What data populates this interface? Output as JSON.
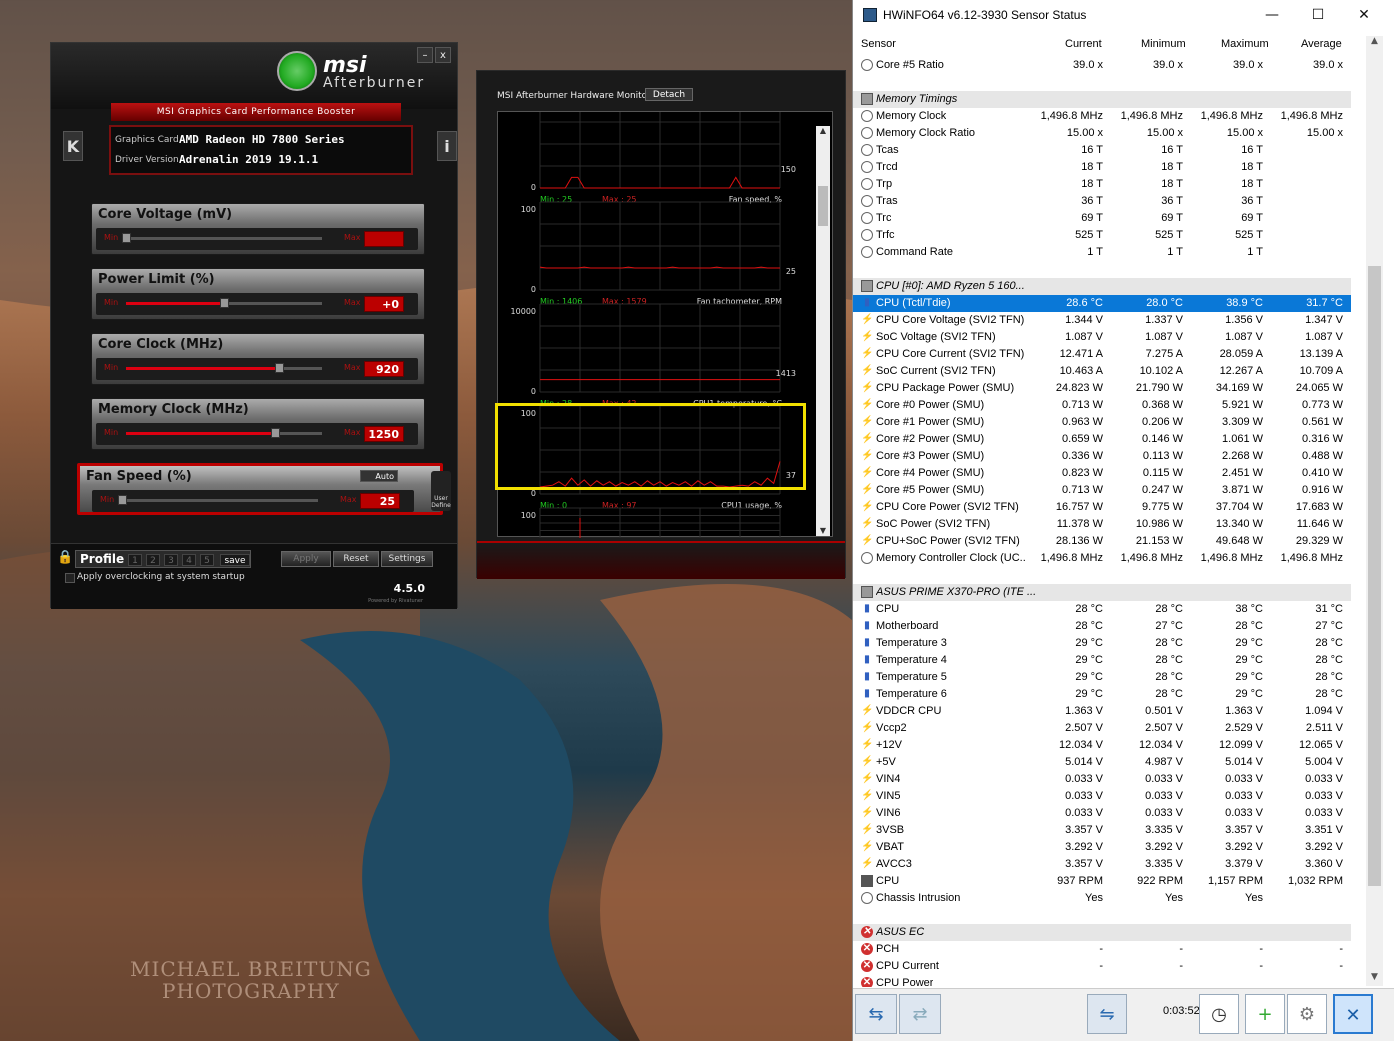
{
  "wallpaper": {
    "watermark_line1": "MICHAEL BREITUNG",
    "watermark_line2": "PHOTOGRAPHY"
  },
  "afterburner": {
    "brand": "msi",
    "product": "Afterburner",
    "banner": "MSI Graphics Card Performance Booster",
    "graphics_card_label": "Graphics Card",
    "graphics_card_value": "AMD Radeon HD 7800 Series",
    "driver_label": "Driver Version",
    "driver_value": "Adrenalin 2019 19.1.1",
    "minimize": "–",
    "close": "x",
    "side_left": "K",
    "side_right": "i",
    "min_label": "Min",
    "max_label": "Max",
    "sliders": [
      {
        "name": "Core Voltage (mV)",
        "value": "",
        "position": 0.0
      },
      {
        "name": "Power Limit (%)",
        "value": "+0",
        "position": 0.5
      },
      {
        "name": "Core Clock (MHz)",
        "value": "920",
        "position": 0.78
      },
      {
        "name": "Memory Clock (MHz)",
        "value": "1250",
        "position": 0.76
      },
      {
        "name": "Fan Speed (%)",
        "value": "25",
        "position": 0.0
      }
    ],
    "fan_auto": "Auto",
    "user_define": "User Define",
    "profile_label": "Profile",
    "profile_slots": [
      "1",
      "2",
      "3",
      "4",
      "5"
    ],
    "save": "save",
    "apply": "Apply",
    "reset": "Reset",
    "settings": "Settings",
    "startup_text": "Apply overclocking at system startup",
    "version": "4.5.0",
    "powered_by": "Powered by Rivatuner"
  },
  "hw_monitor": {
    "title": "MSI Afterburner Hardware Monitor",
    "detach": "Detach",
    "graphs": [
      {
        "ymax": "",
        "ymin": "0",
        "min_text": "Min : 25",
        "max_text": "Max : 25",
        "label": "Fan speed, %",
        "current": "150"
      },
      {
        "ymax": "100",
        "ymin": "0",
        "min_text": "Min : 1406",
        "max_text": "Max : 1579",
        "label": "Fan tachometer, RPM",
        "current": "25"
      },
      {
        "ymax": "10000",
        "ymin": "0",
        "min_text": "Min : 28",
        "max_text": "Max : 42",
        "label": "CPU1 temperature, °C",
        "current": "1413"
      },
      {
        "ymax": "100",
        "ymin": "0",
        "min_text": "Min : 0",
        "max_text": "Max : 97",
        "label": "CPU1 usage, %",
        "current": "37"
      },
      {
        "ymax": "100",
        "ymin": "",
        "min_text": "",
        "max_text": "",
        "label": "",
        "current": ""
      }
    ],
    "highlight_color": "#f2e000",
    "cpu_usage_trace": [
      8,
      9,
      10,
      14,
      9,
      18,
      10,
      16,
      9,
      15,
      10,
      14,
      9,
      13,
      10,
      14,
      9,
      15,
      10,
      14,
      9,
      13,
      10,
      14,
      9,
      15,
      10,
      14,
      9,
      9,
      8,
      9,
      10,
      9,
      14,
      10,
      18,
      12,
      37
    ],
    "fan_speed_trace": [
      0,
      0,
      0,
      0,
      0,
      12,
      12,
      0,
      0,
      0,
      0,
      0,
      0,
      0,
      0,
      0,
      0,
      0,
      0,
      0,
      0,
      0,
      0,
      0,
      0,
      0,
      0,
      0,
      0,
      0,
      0,
      12,
      0,
      0,
      0,
      0,
      0,
      0,
      0
    ]
  },
  "hwinfo": {
    "title": "HWiNFO64 v6.12-3930 Sensor Status",
    "window_min": "—",
    "window_max": "☐",
    "window_close": "✕",
    "columns": [
      "Sensor",
      "Current",
      "Minimum",
      "Maximum",
      "Average"
    ],
    "rows": [
      {
        "type": "item",
        "icon": "clock",
        "name": "Core #5 Ratio",
        "cur": "39.0 x",
        "min": "39.0 x",
        "max": "39.0 x",
        "avg": "39.0 x"
      },
      {
        "type": "blank"
      },
      {
        "type": "group",
        "icon": "mem",
        "name": "Memory Timings"
      },
      {
        "type": "item",
        "icon": "clock",
        "name": "Memory Clock",
        "cur": "1,496.8 MHz",
        "min": "1,496.8 MHz",
        "max": "1,496.8 MHz",
        "avg": "1,496.8 MHz"
      },
      {
        "type": "item",
        "icon": "clock",
        "name": "Memory Clock Ratio",
        "cur": "15.00 x",
        "min": "15.00 x",
        "max": "15.00 x",
        "avg": "15.00 x"
      },
      {
        "type": "item",
        "icon": "clock",
        "name": "Tcas",
        "cur": "16 T",
        "min": "16 T",
        "max": "16 T",
        "avg": ""
      },
      {
        "type": "item",
        "icon": "clock",
        "name": "Trcd",
        "cur": "18 T",
        "min": "18 T",
        "max": "18 T",
        "avg": ""
      },
      {
        "type": "item",
        "icon": "clock",
        "name": "Trp",
        "cur": "18 T",
        "min": "18 T",
        "max": "18 T",
        "avg": ""
      },
      {
        "type": "item",
        "icon": "clock",
        "name": "Tras",
        "cur": "36 T",
        "min": "36 T",
        "max": "36 T",
        "avg": ""
      },
      {
        "type": "item",
        "icon": "clock",
        "name": "Trc",
        "cur": "69 T",
        "min": "69 T",
        "max": "69 T",
        "avg": ""
      },
      {
        "type": "item",
        "icon": "clock",
        "name": "Trfc",
        "cur": "525 T",
        "min": "525 T",
        "max": "525 T",
        "avg": ""
      },
      {
        "type": "item",
        "icon": "clock",
        "name": "Command Rate",
        "cur": "1 T",
        "min": "1 T",
        "max": "1 T",
        "avg": ""
      },
      {
        "type": "blank"
      },
      {
        "type": "group",
        "icon": "mem",
        "name": "CPU [#0]: AMD Ryzen 5 160..."
      },
      {
        "type": "item",
        "icon": "therm",
        "name": "CPU (Tctl/Tdie)",
        "cur": "28.6 °C",
        "min": "28.0 °C",
        "max": "38.9 °C",
        "avg": "31.7 °C",
        "selected": true
      },
      {
        "type": "item",
        "icon": "bolt",
        "name": "CPU Core Voltage (SVI2 TFN)",
        "cur": "1.344 V",
        "min": "1.337 V",
        "max": "1.356 V",
        "avg": "1.347 V"
      },
      {
        "type": "item",
        "icon": "bolt",
        "name": "SoC Voltage (SVI2 TFN)",
        "cur": "1.087 V",
        "min": "1.087 V",
        "max": "1.087 V",
        "avg": "1.087 V"
      },
      {
        "type": "item",
        "icon": "bolt",
        "name": "CPU Core Current (SVI2 TFN)",
        "cur": "12.471 A",
        "min": "7.275 A",
        "max": "28.059 A",
        "avg": "13.139 A"
      },
      {
        "type": "item",
        "icon": "bolt",
        "name": "SoC Current (SVI2 TFN)",
        "cur": "10.463 A",
        "min": "10.102 A",
        "max": "12.267 A",
        "avg": "10.709 A"
      },
      {
        "type": "item",
        "icon": "bolt",
        "name": "CPU Package Power (SMU)",
        "cur": "24.823 W",
        "min": "21.790 W",
        "max": "34.169 W",
        "avg": "24.065 W"
      },
      {
        "type": "item",
        "icon": "bolt",
        "name": "Core #0 Power (SMU)",
        "cur": "0.713 W",
        "min": "0.368 W",
        "max": "5.921 W",
        "avg": "0.773 W"
      },
      {
        "type": "item",
        "icon": "bolt",
        "name": "Core #1 Power (SMU)",
        "cur": "0.963 W",
        "min": "0.206 W",
        "max": "3.309 W",
        "avg": "0.561 W"
      },
      {
        "type": "item",
        "icon": "bolt",
        "name": "Core #2 Power (SMU)",
        "cur": "0.659 W",
        "min": "0.146 W",
        "max": "1.061 W",
        "avg": "0.316 W"
      },
      {
        "type": "item",
        "icon": "bolt",
        "name": "Core #3 Power (SMU)",
        "cur": "0.336 W",
        "min": "0.113 W",
        "max": "2.268 W",
        "avg": "0.488 W"
      },
      {
        "type": "item",
        "icon": "bolt",
        "name": "Core #4 Power (SMU)",
        "cur": "0.823 W",
        "min": "0.115 W",
        "max": "2.451 W",
        "avg": "0.410 W"
      },
      {
        "type": "item",
        "icon": "bolt",
        "name": "Core #5 Power (SMU)",
        "cur": "0.713 W",
        "min": "0.247 W",
        "max": "3.871 W",
        "avg": "0.916 W"
      },
      {
        "type": "item",
        "icon": "bolt",
        "name": "CPU Core Power (SVI2 TFN)",
        "cur": "16.757 W",
        "min": "9.775 W",
        "max": "37.704 W",
        "avg": "17.683 W"
      },
      {
        "type": "item",
        "icon": "bolt",
        "name": "SoC Power (SVI2 TFN)",
        "cur": "11.378 W",
        "min": "10.986 W",
        "max": "13.340 W",
        "avg": "11.646 W"
      },
      {
        "type": "item",
        "icon": "bolt",
        "name": "CPU+SoC Power (SVI2 TFN)",
        "cur": "28.136 W",
        "min": "21.153 W",
        "max": "49.648 W",
        "avg": "29.329 W"
      },
      {
        "type": "item",
        "icon": "clock",
        "name": "Memory Controller Clock (UC...",
        "cur": "1,496.8 MHz",
        "min": "1,496.8 MHz",
        "max": "1,496.8 MHz",
        "avg": "1,496.8 MHz"
      },
      {
        "type": "blank"
      },
      {
        "type": "group",
        "icon": "mem",
        "name": "ASUS PRIME X370-PRO (ITE ..."
      },
      {
        "type": "item",
        "icon": "therm",
        "name": "CPU",
        "cur": "28 °C",
        "min": "28 °C",
        "max": "38 °C",
        "avg": "31 °C"
      },
      {
        "type": "item",
        "icon": "therm",
        "name": "Motherboard",
        "cur": "28 °C",
        "min": "27 °C",
        "max": "28 °C",
        "avg": "27 °C"
      },
      {
        "type": "item",
        "icon": "therm",
        "name": "Temperature 3",
        "cur": "29 °C",
        "min": "28 °C",
        "max": "29 °C",
        "avg": "28 °C"
      },
      {
        "type": "item",
        "icon": "therm",
        "name": "Temperature 4",
        "cur": "29 °C",
        "min": "28 °C",
        "max": "29 °C",
        "avg": "28 °C"
      },
      {
        "type": "item",
        "icon": "therm",
        "name": "Temperature 5",
        "cur": "29 °C",
        "min": "28 °C",
        "max": "29 °C",
        "avg": "28 °C"
      },
      {
        "type": "item",
        "icon": "therm",
        "name": "Temperature 6",
        "cur": "29 °C",
        "min": "28 °C",
        "max": "29 °C",
        "avg": "28 °C"
      },
      {
        "type": "item",
        "icon": "bolt",
        "name": "VDDCR CPU",
        "cur": "1.363 V",
        "min": "0.501 V",
        "max": "1.363 V",
        "avg": "1.094 V"
      },
      {
        "type": "item",
        "icon": "bolt",
        "name": "Vccp2",
        "cur": "2.507 V",
        "min": "2.507 V",
        "max": "2.529 V",
        "avg": "2.511 V"
      },
      {
        "type": "item",
        "icon": "bolt",
        "name": "+12V",
        "cur": "12.034 V",
        "min": "12.034 V",
        "max": "12.099 V",
        "avg": "12.065 V"
      },
      {
        "type": "item",
        "icon": "bolt",
        "name": "+5V",
        "cur": "5.014 V",
        "min": "4.987 V",
        "max": "5.014 V",
        "avg": "5.004 V"
      },
      {
        "type": "item",
        "icon": "bolt",
        "name": "VIN4",
        "cur": "0.033 V",
        "min": "0.033 V",
        "max": "0.033 V",
        "avg": "0.033 V"
      },
      {
        "type": "item",
        "icon": "bolt",
        "name": "VIN5",
        "cur": "0.033 V",
        "min": "0.033 V",
        "max": "0.033 V",
        "avg": "0.033 V"
      },
      {
        "type": "item",
        "icon": "bolt",
        "name": "VIN6",
        "cur": "0.033 V",
        "min": "0.033 V",
        "max": "0.033 V",
        "avg": "0.033 V"
      },
      {
        "type": "item",
        "icon": "bolt",
        "name": "3VSB",
        "cur": "3.357 V",
        "min": "3.335 V",
        "max": "3.357 V",
        "avg": "3.351 V"
      },
      {
        "type": "item",
        "icon": "bolt",
        "name": "VBAT",
        "cur": "3.292 V",
        "min": "3.292 V",
        "max": "3.292 V",
        "avg": "3.292 V"
      },
      {
        "type": "item",
        "icon": "bolt",
        "name": "AVCC3",
        "cur": "3.357 V",
        "min": "3.335 V",
        "max": "3.379 V",
        "avg": "3.360 V"
      },
      {
        "type": "item",
        "icon": "fan",
        "name": "CPU",
        "cur": "937 RPM",
        "min": "922 RPM",
        "max": "1,157 RPM",
        "avg": "1,032 RPM"
      },
      {
        "type": "item",
        "icon": "clock",
        "name": "Chassis Intrusion",
        "cur": "Yes",
        "min": "Yes",
        "max": "Yes",
        "avg": ""
      },
      {
        "type": "blank"
      },
      {
        "type": "group",
        "icon": "x",
        "name": "ASUS EC"
      },
      {
        "type": "item",
        "icon": "x",
        "name": "PCH",
        "cur": "-",
        "min": "-",
        "max": "-",
        "avg": "-"
      },
      {
        "type": "item",
        "icon": "x",
        "name": "CPU Current",
        "cur": "-",
        "min": "-",
        "max": "-",
        "avg": "-"
      },
      {
        "type": "item",
        "icon": "x",
        "name": "CPU Power",
        "cur": "",
        "min": "",
        "max": "",
        "avg": ""
      }
    ],
    "elapsed_time": "0:03:52"
  }
}
